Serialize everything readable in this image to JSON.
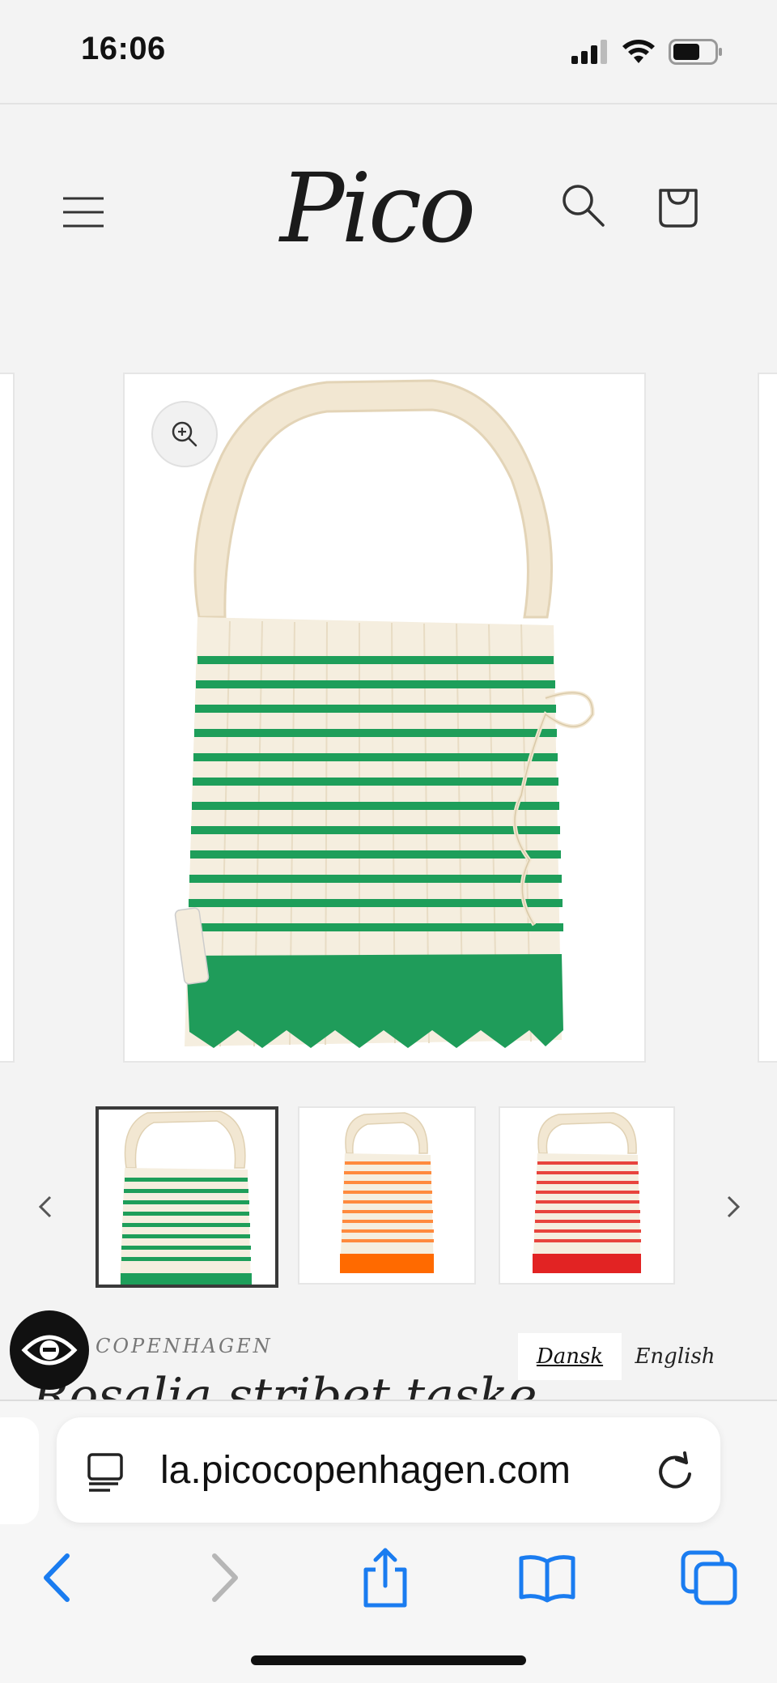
{
  "status_bar": {
    "time": "16:06",
    "icons": [
      "signal-icon",
      "wifi-icon",
      "battery-icon"
    ]
  },
  "header": {
    "logo_text": "Pico",
    "icons": [
      "hamburger-menu-icon",
      "search-icon",
      "cart-icon"
    ]
  },
  "gallery": {
    "main_product_colors": {
      "stripe": "#1e9e5a",
      "base": "#f4ecdc",
      "bottom": "#1f9c5a"
    },
    "thumbnails": [
      {
        "stripe": "#1e9e5a",
        "bottom": "#1f9c5a",
        "selected": true
      },
      {
        "stripe": "#ff8a3d",
        "bottom": "#ff6a00",
        "selected": false
      },
      {
        "stripe": "#e8443d",
        "bottom": "#e22323",
        "selected": false
      }
    ]
  },
  "product": {
    "vendor": "COPENHAGEN",
    "title": "Rosalia stribet taske"
  },
  "language": {
    "dansk": "Dansk",
    "english": "English"
  },
  "browser": {
    "url": "la.picocopenhagen.com",
    "icons": [
      "reader-icon",
      "reload-icon",
      "back-icon",
      "forward-icon",
      "share-icon",
      "bookmarks-icon",
      "tabs-icon"
    ]
  },
  "colors": {
    "accent": "#1a7cf0",
    "background": "#f3f3f3"
  }
}
